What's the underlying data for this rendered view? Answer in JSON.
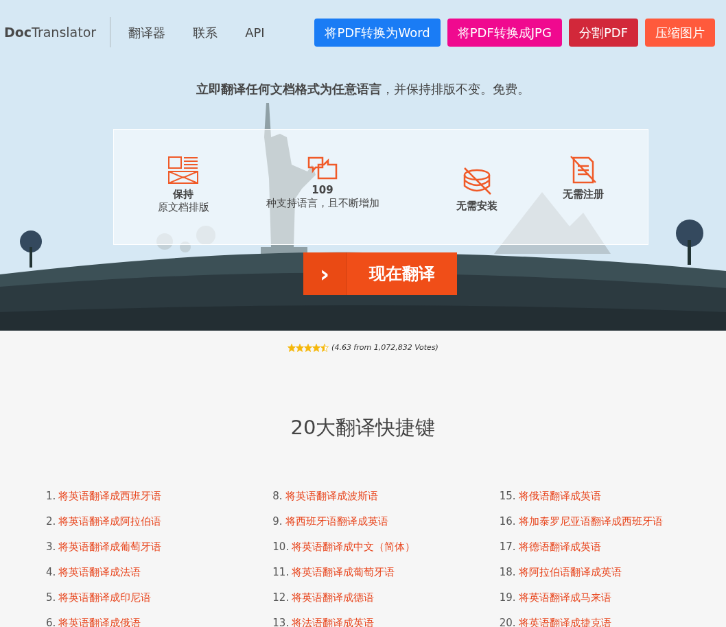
{
  "header": {
    "logo": {
      "bold": "Doc",
      "rest": "Translator"
    },
    "nav": [
      "翻译器",
      "联系",
      "API"
    ],
    "buttons": [
      {
        "label": "将PDF转换为Word",
        "color": "#1a7cf5"
      },
      {
        "label": "将PDF转换成JPG",
        "color": "#f0098f"
      },
      {
        "label": "分割PDF",
        "color": "#d2283a"
      },
      {
        "label": "压缩图片",
        "color": "#ff5a3c"
      }
    ]
  },
  "hero": {
    "tagline": "**立即翻译任何文档格式为任意语言**，并保持排版不变。免费。",
    "features": [
      {
        "title": "保持",
        "subtitle": "原文档排版"
      },
      {
        "title": "109",
        "subtitle": "种支持语言，且不断增加"
      },
      {
        "title": "无需安装"
      },
      {
        "title": "无需注册"
      }
    ],
    "cta": {
      "arrow": "›",
      "label": "现在翻译"
    }
  },
  "rating": {
    "stars": 4.5,
    "text": "(4.63 from 1,072,832 Votes)"
  },
  "shortcuts": {
    "title": "20大翻译快捷键",
    "columns": [
      [
        {
          "number": "1.",
          "label": "将英语翻译成西班牙语"
        },
        {
          "number": "2.",
          "label": "将英语翻译成阿拉伯语"
        },
        {
          "number": "3.",
          "label": "将英语翻译成葡萄牙语"
        },
        {
          "number": "4.",
          "label": "将英语翻译成法语"
        },
        {
          "number": "5.",
          "label": "将英语翻译成印尼语"
        },
        {
          "number": "6.",
          "label": "将英语翻译成俄语"
        }
      ],
      [
        {
          "number": "8.",
          "label": "将英语翻译成波斯语"
        },
        {
          "number": "9.",
          "label": "将西班牙语翻译成英语"
        },
        {
          "number": "10.",
          "label": "将英语翻译成中文（简体）"
        },
        {
          "number": "11.",
          "label": "将英语翻译成葡萄牙语"
        },
        {
          "number": "12.",
          "label": "将英语翻译成德语"
        },
        {
          "number": "13.",
          "label": "将法语翻译成英语"
        }
      ],
      [
        {
          "number": "15.",
          "label": "将俄语翻译成英语"
        },
        {
          "number": "16.",
          "label": "将加泰罗尼亚语翻译成西班牙语"
        },
        {
          "number": "17.",
          "label": "将德语翻译成英语"
        },
        {
          "number": "18.",
          "label": "将阿拉伯语翻译成英语"
        },
        {
          "number": "19.",
          "label": "将英语翻译成马来语"
        },
        {
          "number": "20.",
          "label": "将英语翻译成捷克语"
        }
      ]
    ]
  }
}
